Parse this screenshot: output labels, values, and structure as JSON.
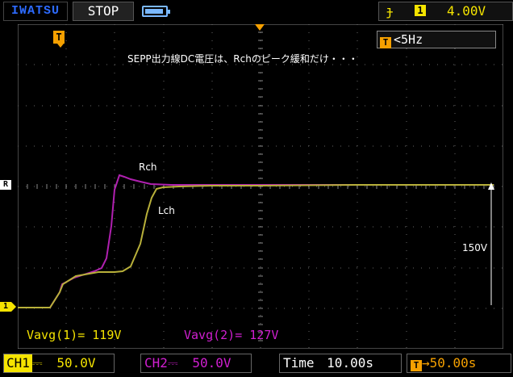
{
  "top_bar": {
    "brand": "IWATSU",
    "run_state": "STOP",
    "trigger_edge_symbol": "ɟ",
    "trigger_channel": "1",
    "trigger_level": "4.00V"
  },
  "screen": {
    "trigger_marker": "T",
    "freq_label": "<5Hz",
    "freq_marker": "T",
    "caption": "SEPP出力線DC電圧は、Rchのピーク緩和だけ・・・",
    "rch_label": "Rch",
    "lch_label": "Lch",
    "scale_label": "150V",
    "ch1_ground_marker": "1",
    "ref_marker": "R",
    "measurements": {
      "ch1": "Vavg(1)= 119V",
      "ch2": "Vavg(2)= 127V"
    }
  },
  "bottom_bar": {
    "ch1_tag": "CH1",
    "ch1_coupling": "⎓",
    "ch1_scale": "50.0V",
    "ch2_label": "CH2",
    "ch2_coupling": "⎓",
    "ch2_scale": "50.0V",
    "time_label": "Time",
    "time_scale": "10.00s",
    "trigger_marker": "T",
    "trigger_pos": "→50.00s"
  },
  "colors": {
    "ch1": "#b8b03a",
    "ch2": "#b020b0",
    "yellow": "#f5e400",
    "orange": "#f5a000",
    "brand": "#2d6bff"
  },
  "chart_data": {
    "type": "line",
    "xlabel": "",
    "ylabel": "",
    "series": [
      {
        "name": "Rch",
        "x": [
          0,
          1,
          2,
          3,
          4,
          5,
          6,
          7,
          8,
          9,
          10,
          11
        ],
        "values": [
          0,
          0,
          0,
          0.36,
          0.48,
          0.5,
          0.53,
          1.1,
          1.3,
          1.2,
          1.2,
          1.2
        ]
      },
      {
        "name": "Lch",
        "x": [
          0,
          1,
          2,
          3,
          4,
          5,
          6,
          7,
          8,
          9,
          10,
          11
        ],
        "values": [
          0,
          0,
          0,
          0.36,
          0.45,
          0.48,
          0.5,
          0.52,
          0.75,
          1.0,
          1.2,
          1.2
        ]
      }
    ]
  }
}
